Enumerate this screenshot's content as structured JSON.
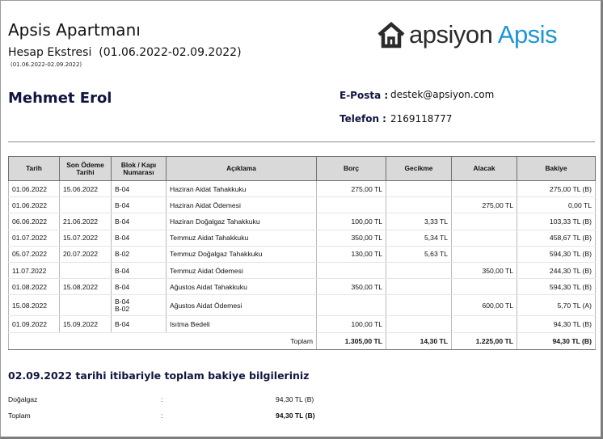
{
  "header": {
    "title": "Apsis Apartmanı",
    "subtitle": "Hesap Ekstresi  (01.06.2022-02.09.2022)",
    "small_range": "(01.06.2022-02.09.2022)",
    "logo": {
      "left": "apsiyon",
      "right": "Apsis",
      "icon": "house-logo-icon",
      "brand_blue": "#1e96d4",
      "brand_dark": "#2b2b2b"
    }
  },
  "customer": {
    "name": "Mehmet Erol",
    "email_label": "E-Posta :",
    "email": "destek@apsiyon.com",
    "phone_label": "Telefon :",
    "phone": "2169118777"
  },
  "table": {
    "headers": {
      "date": "Tarih",
      "due_1": "Son Ödeme",
      "due_2": "Tarihi",
      "unit_1": "Blok / Kapı",
      "unit_2": "Numarası",
      "desc": "Açıklama",
      "debt": "Borç",
      "late": "Gecikme",
      "credit": "Alacak",
      "balance": "Bakiye"
    },
    "rows": [
      {
        "date": "01.06.2022",
        "due": "15.06.2022",
        "unit": "B-04",
        "unit2": "",
        "desc": "Haziran Aidat Tahakkuku",
        "debt": "275,00 TL",
        "late": "",
        "credit": "",
        "balance": "275,00 TL (B)"
      },
      {
        "date": "01.06.2022",
        "due": "",
        "unit": "B-04",
        "unit2": "",
        "desc": "Haziran Aidat Ödemesi",
        "debt": "",
        "late": "",
        "credit": "275,00 TL",
        "balance": "0,00 TL"
      },
      {
        "date": "06.06.2022",
        "due": "21.06.2022",
        "unit": "B-04",
        "unit2": "",
        "desc": "Haziran Doğalgaz Tahakkuku",
        "debt": "100,00 TL",
        "late": "3,33 TL",
        "credit": "",
        "balance": "103,33 TL (B)"
      },
      {
        "date": "01.07.2022",
        "due": "15.07.2022",
        "unit": "B-04",
        "unit2": "",
        "desc": "Temmuz Aidat Tahakkuku",
        "debt": "350,00 TL",
        "late": "5,34 TL",
        "credit": "",
        "balance": "458,67 TL (B)"
      },
      {
        "date": "05.07.2022",
        "due": "20.07.2022",
        "unit": "B-02",
        "unit2": "",
        "desc": "Temmuz Doğalgaz Tahakkuku",
        "debt": "130,00 TL",
        "late": "5,63 TL",
        "credit": "",
        "balance": "594,30 TL (B)"
      },
      {
        "date": "11.07.2022",
        "due": "",
        "unit": "B-04",
        "unit2": "",
        "desc": "Temmuz Aidat Ödemesi",
        "debt": "",
        "late": "",
        "credit": "350,00 TL",
        "balance": "244,30 TL (B)"
      },
      {
        "date": "01.08.2022",
        "due": "15.08.2022",
        "unit": "B-04",
        "unit2": "",
        "desc": "Ağustos Aidat Tahakkuku",
        "debt": "350,00 TL",
        "late": "",
        "credit": "",
        "balance": "594,30 TL (B)"
      },
      {
        "date": "15.08.2022",
        "due": "",
        "unit": "B-04",
        "unit2": "B-02",
        "desc": "Ağustos Aidat Ödemesi",
        "debt": "",
        "late": "",
        "credit": "600,00 TL",
        "balance": "5,70 TL (A)"
      },
      {
        "date": "01.09.2022",
        "due": "15.09.2022",
        "unit": "B-04",
        "unit2": "",
        "desc": "Isıtma Bedeli",
        "debt": "100,00 TL",
        "late": "",
        "credit": "",
        "balance": "94,30 TL (B)"
      }
    ],
    "total": {
      "label": "Toplam",
      "debt": "1.305,00 TL",
      "late": "14,30 TL",
      "credit": "1.225,00 TL",
      "balance": "94,30 TL (B)"
    }
  },
  "summary": {
    "title": "02.09.2022 tarihi itibariyle toplam bakiye bilgileriniz",
    "rows": [
      {
        "label": "Doğalgaz",
        "colon": ":",
        "value": "94,30 TL (B)"
      },
      {
        "label": "Toplam",
        "colon": ":",
        "value": "94,30 TL (B)"
      }
    ]
  }
}
